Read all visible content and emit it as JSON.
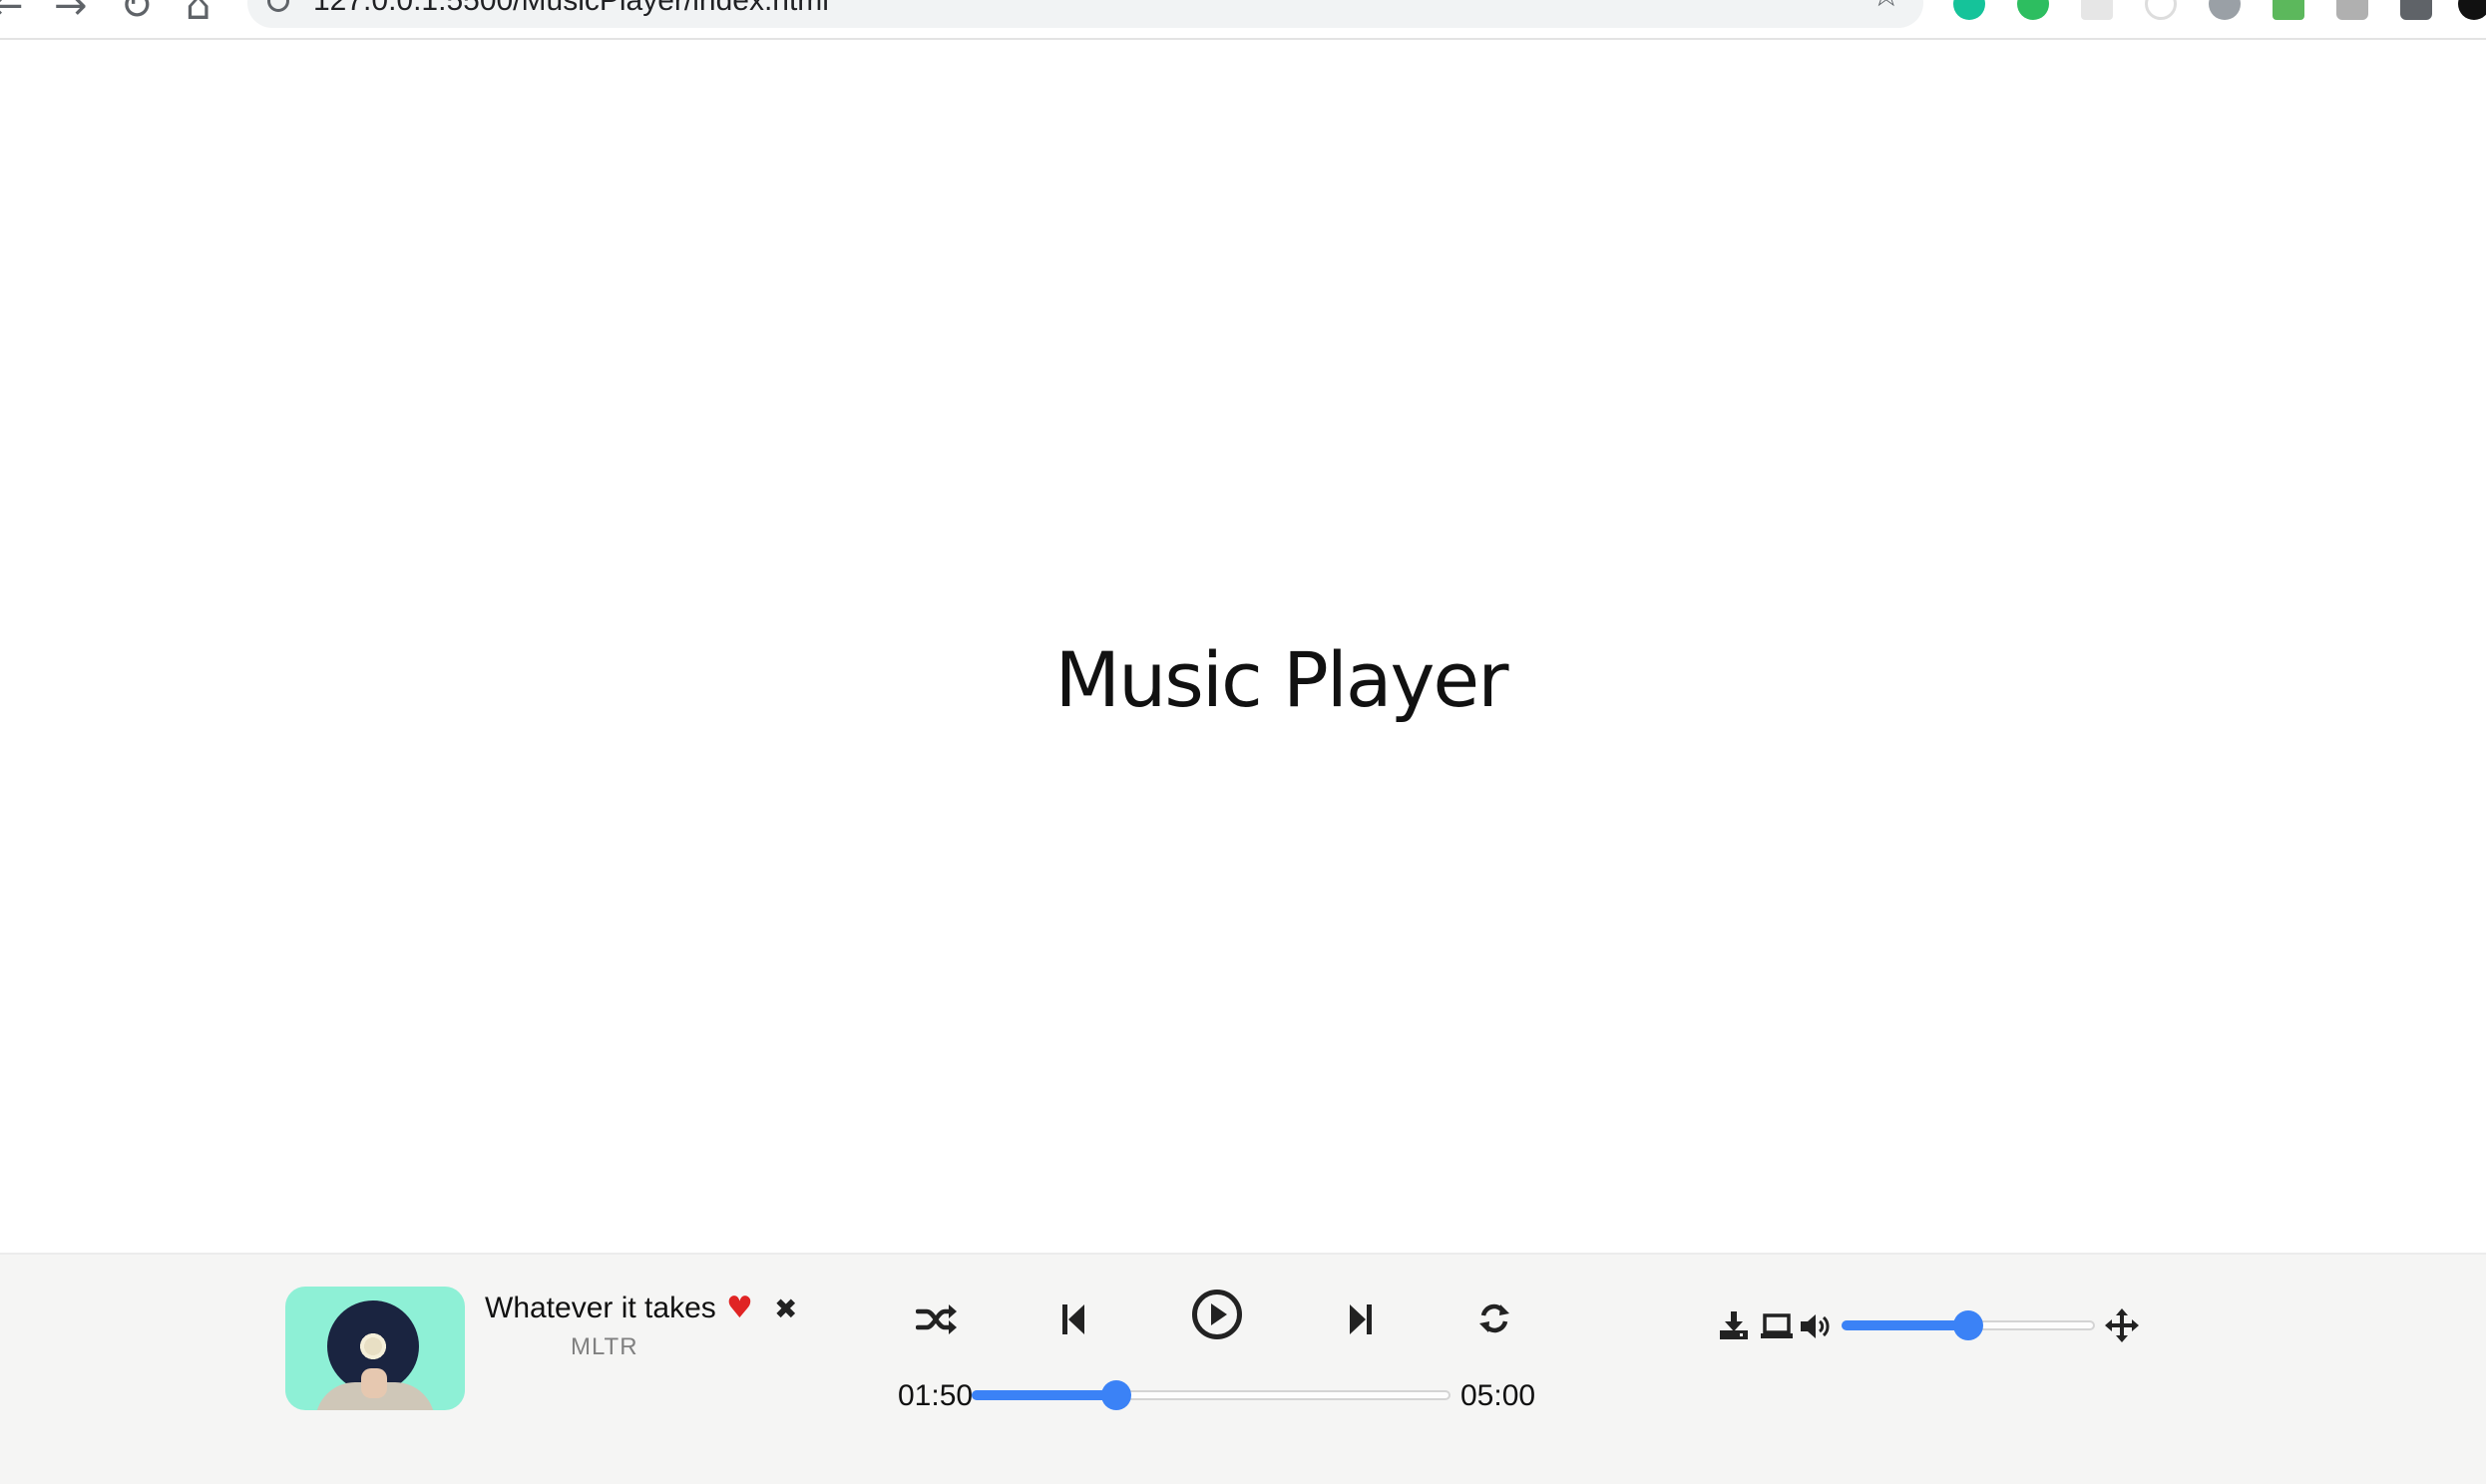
{
  "browser": {
    "url": "127.0.0.1:5500/MusicPlayer/index.html"
  },
  "page": {
    "title": "Music Player"
  },
  "player": {
    "track_title": "Whatever it takes",
    "artist": "MLTR",
    "current_time": "01:50",
    "duration": "05:00",
    "progress_fraction": 0.3,
    "volume_fraction": 0.5,
    "accent_color": "#3b82f6",
    "favorite_color": "#e02424",
    "icons": [
      "heart-icon",
      "close-icon",
      "shuffle-icon",
      "previous-icon",
      "play-icon",
      "next-icon",
      "repeat-icon",
      "download-icon",
      "laptop-icon",
      "volume-icon",
      "move-icon"
    ]
  }
}
